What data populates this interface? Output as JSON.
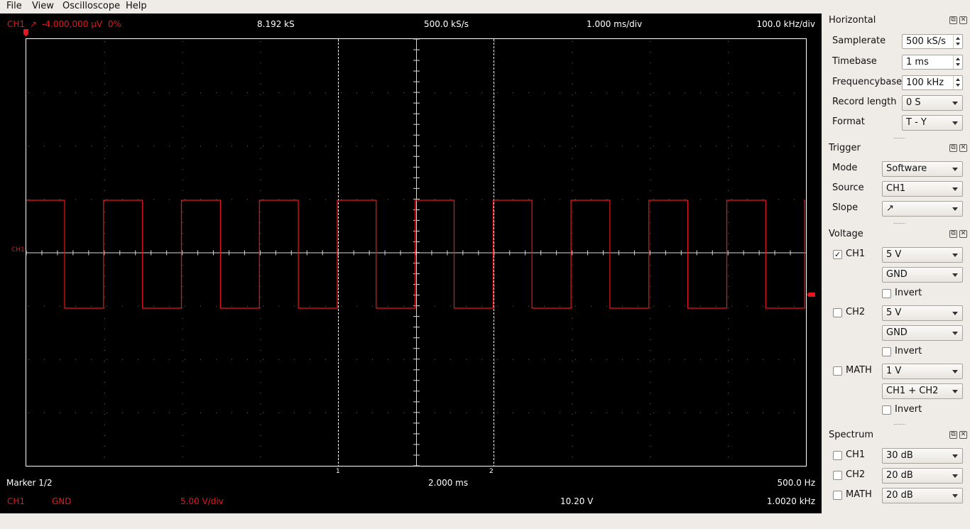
{
  "menu": {
    "file": "File",
    "view": "View",
    "oscilloscope": "Oscilloscope",
    "help": "Help"
  },
  "scope": {
    "top": {
      "channel": "CH1",
      "slope_glyph": "↗",
      "trigger_level": "-4.000,000 µV",
      "trigger_pos": "0%",
      "samples": "8.192 kS",
      "samplerate": "500.0 kS/s",
      "timebase": "1.000 ms/div",
      "frequencybase": "100.0 kHz/div"
    },
    "channel_label": "CH1",
    "marker1_label": "1",
    "marker2_label": "2",
    "marker_info": "Marker 1/2",
    "marker_time": "2.000 ms",
    "marker_freq": "500.0 Hz",
    "bottom": {
      "channel": "CH1",
      "coupling": "GND",
      "voltage_div": "5.00 V/div",
      "amplitude": "10.20 V",
      "frequency": "1.0020 kHz"
    },
    "colors": {
      "trace": "#e8151b",
      "grid": "#ffffff",
      "background": "#000000"
    }
  },
  "horizontal": {
    "title": "Horizontal",
    "samplerate_label": "Samplerate",
    "samplerate_value": "500 kS/s",
    "timebase_label": "Timebase",
    "timebase_value": "1 ms",
    "frequencybase_label": "Frequencybase",
    "frequencybase_value": "100 kHz",
    "record_length_label": "Record length",
    "record_length_value": "0 S",
    "format_label": "Format",
    "format_value": "T - Y"
  },
  "trigger": {
    "title": "Trigger",
    "mode_label": "Mode",
    "mode_value": "Software",
    "source_label": "Source",
    "source_value": "CH1",
    "slope_label": "Slope",
    "slope_value": "↗"
  },
  "voltage": {
    "title": "Voltage",
    "ch1_label": "CH1",
    "ch1_checked": "✓",
    "ch1_gain": "5 V",
    "ch1_coupling": "GND",
    "ch1_invert": "Invert",
    "ch2_label": "CH2",
    "ch2_gain": "5 V",
    "ch2_coupling": "GND",
    "ch2_invert": "Invert",
    "math_label": "MATH",
    "math_gain": "1 V",
    "math_mode": "CH1 + CH2",
    "math_invert": "Invert"
  },
  "spectrum": {
    "title": "Spectrum",
    "ch1_label": "CH1",
    "ch1_value": "30 dB",
    "ch2_label": "CH2",
    "ch2_value": "20 dB",
    "math_label": "MATH",
    "math_value": "20 dB"
  },
  "dock_icons": {
    "float": "float-icon",
    "close": "close-icon"
  }
}
